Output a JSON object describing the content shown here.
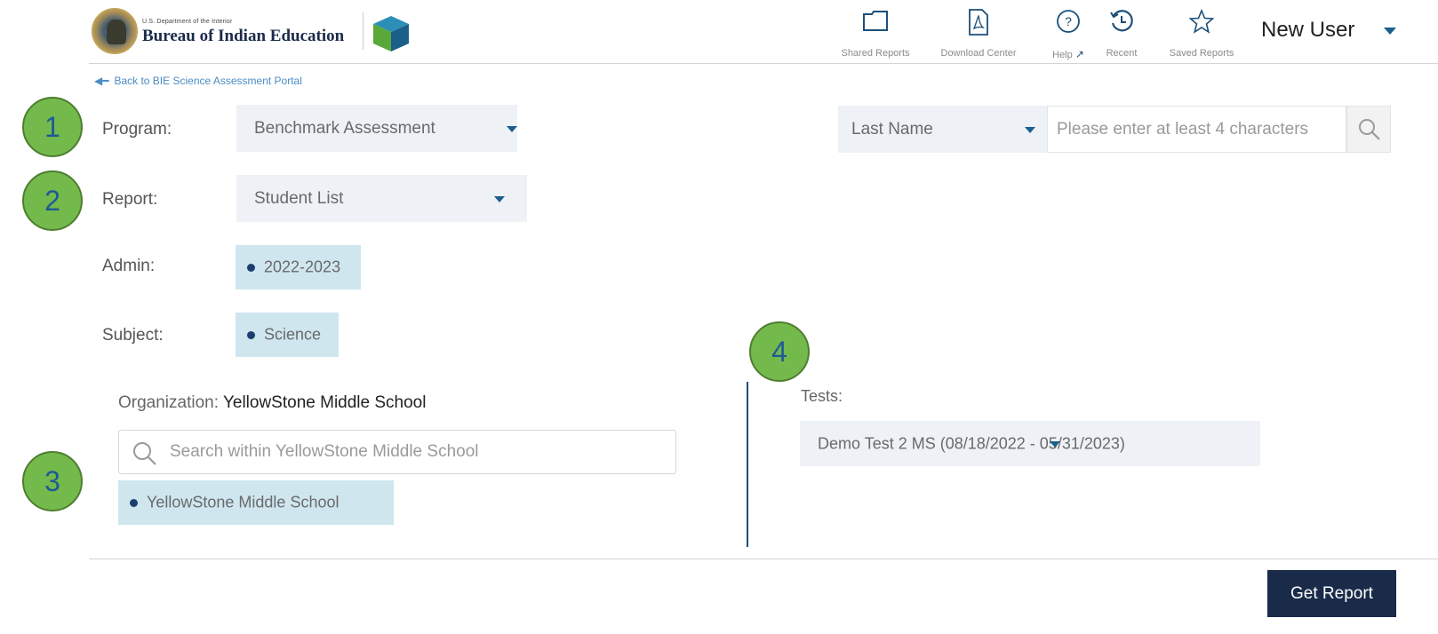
{
  "header": {
    "dept_text": "U.S. Department of the Interior",
    "bureau_text": "Bureau of Indian Education",
    "nav": [
      {
        "label": "Shared Reports",
        "icon": "folder-icon"
      },
      {
        "label": "Download Center",
        "icon": "pdf-file-icon"
      },
      {
        "label": "Help",
        "icon": "help-circle-icon"
      },
      {
        "label": "Recent",
        "icon": "history-icon"
      },
      {
        "label": "Saved Reports",
        "icon": "star-icon"
      }
    ],
    "user_name": "New User"
  },
  "back_link": "Back to BIE Science Assessment Portal",
  "badges": [
    "1",
    "2",
    "3",
    "4"
  ],
  "form": {
    "program_label": "Program:",
    "program_value": "Benchmark Assessment",
    "report_label": "Report:",
    "report_value": "Student List",
    "admin_label": "Admin:",
    "admin_value": "2022-2023",
    "subject_label": "Subject:",
    "subject_value": "Science"
  },
  "student_search": {
    "field_value": "Last Name",
    "placeholder": "Please enter at least 4 characters"
  },
  "organization": {
    "label": "Organization:",
    "name": "YellowStone Middle School",
    "search_placeholder": "Search within YellowStone Middle School",
    "selected": "YellowStone Middle School"
  },
  "tests": {
    "label": "Tests:",
    "value": "Demo Test 2 MS (08/18/2022 - 05/31/2023)"
  },
  "actions": {
    "get_report": "Get Report"
  },
  "colors": {
    "brand_navy": "#1a2b4a",
    "accent_blue": "#1b5f8f",
    "chip_bg": "#cfe6ef",
    "dropdown_bg": "#eef2f6",
    "badge_green": "#74b94c"
  }
}
